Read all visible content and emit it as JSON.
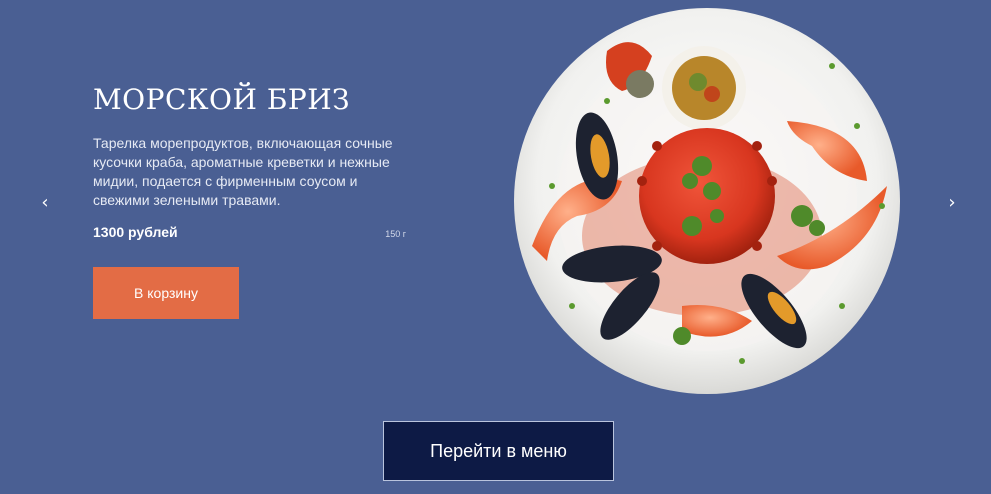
{
  "slide": {
    "title": "МОРСКОЙ БРИЗ",
    "description": "Тарелка морепродуктов, включающая сочные кусочки краба, ароматные креветки и нежные мидии, подается с фирменным соусом и свежими зелеными травами.",
    "price": "1300 рублей",
    "weight": "150 г",
    "cart_label": "В корзину",
    "image_icon": "seafood-plate-photo"
  },
  "nav": {
    "prev_icon": "‹",
    "next_icon": "›"
  },
  "menu_button_label": "Перейти в меню",
  "colors": {
    "background": "#4a5f93",
    "cart_button": "#e36c45",
    "menu_button": "#0d1a45"
  }
}
